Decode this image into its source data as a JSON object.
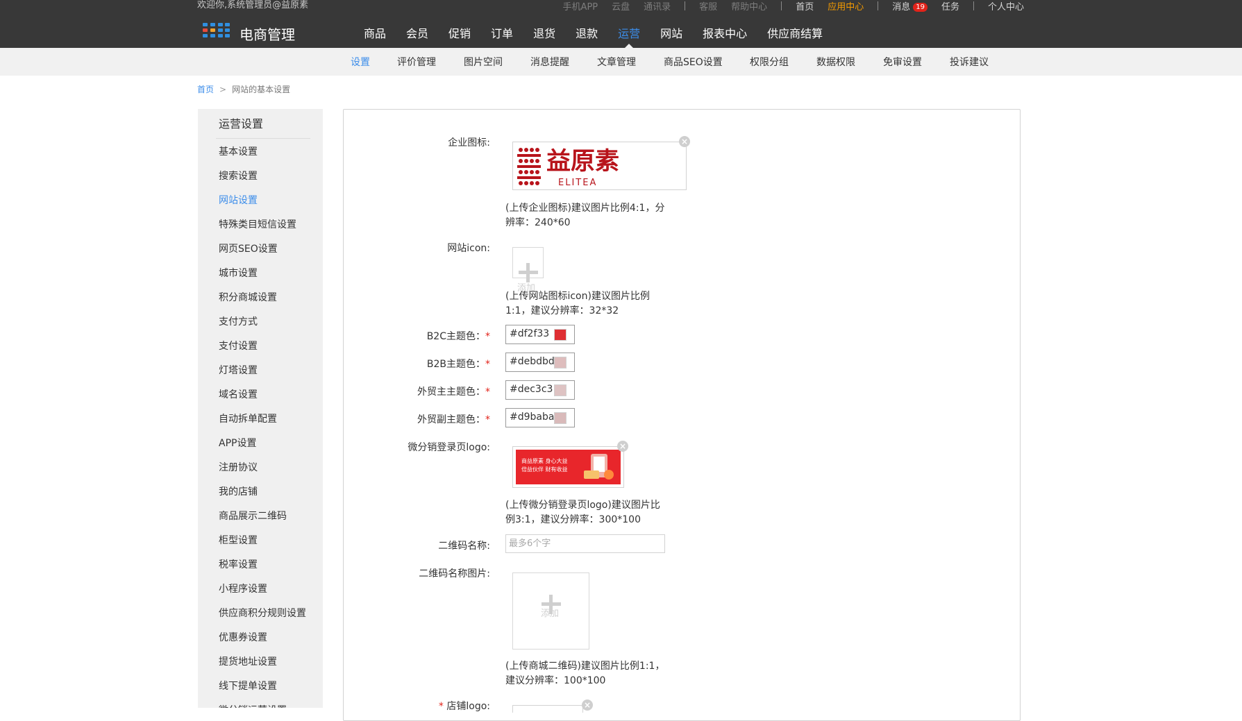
{
  "header": {
    "welcome": "欢迎你,系统管理员@益原素",
    "toplinks": {
      "mobile_app": "手机APP",
      "cloud": "云盘",
      "contacts": "通讯录",
      "service": "客服",
      "help": "帮助中心",
      "home": "首页",
      "app_center": "应用中心",
      "messages": "消息",
      "message_count": "19",
      "tasks": "任务",
      "personal": "个人中心"
    },
    "brand": "电商管理",
    "main_nav": [
      "商品",
      "会员",
      "促销",
      "订单",
      "退货",
      "退款",
      "运营",
      "网站",
      "报表中心",
      "供应商结算"
    ],
    "main_nav_active": "运营"
  },
  "subnav": {
    "items": [
      "设置",
      "评价管理",
      "图片空间",
      "消息提醒",
      "文章管理",
      "商品SEO设置",
      "权限分组",
      "数据权限",
      "免审设置",
      "投诉建议"
    ],
    "active": "设置"
  },
  "breadcrumb": {
    "home": "首页",
    "separator": ">",
    "current": "网站的基本设置"
  },
  "sidebar": {
    "title": "运营设置",
    "items": [
      "基本设置",
      "搜索设置",
      "网站设置",
      "特殊类目短信设置",
      "网页SEO设置",
      "城市设置",
      "积分商城设置",
      "支付方式",
      "支付设置",
      "灯塔设置",
      "域名设置",
      "自动拆单配置",
      "APP设置",
      "注册协议",
      "我的店铺",
      "商品展示二维码",
      "柜型设置",
      "税率设置",
      "小程序设置",
      "供应商积分规则设置",
      "优惠券设置",
      "提货地址设置",
      "线下提单设置",
      "微分销运营设置"
    ],
    "active": "网站设置"
  },
  "form": {
    "company_logo": {
      "label": "企业图标:",
      "logo_text_cn": "益原素",
      "logo_text_en": "ELITEA",
      "hint_line1": "(上传企业图标)建议图片比例4:1，分",
      "hint_line2": "辨率：240*60"
    },
    "site_icon": {
      "label": "网站icon:",
      "add": "添加",
      "hint_line1": "(上传网站图标icon)建议图片比例",
      "hint_line2": "1:1，建议分辨率：32*32"
    },
    "b2c_color": {
      "label": "B2C主题色：",
      "value": "#df2f33",
      "swatch": "#df2f33"
    },
    "b2b_color": {
      "label": "B2B主题色：",
      "value": "#debdbd",
      "swatch": "#debdbd"
    },
    "foreign_main_color": {
      "label": "外贸主主题色：",
      "value": "#dec3c3",
      "swatch": "#dec3c3"
    },
    "foreign_sub_color": {
      "label": "外贸副主题色：",
      "value": "#d9baba",
      "swatch": "#d9baba"
    },
    "required_mark": "*",
    "wdx_logo": {
      "label": "微分销登录页logo:",
      "banner_line1": "商益原素  身心大益",
      "banner_line2": "倍益伙伴  财有收益",
      "hint_line1": "(上传微分销登录页logo)建议图片比",
      "hint_line2": "例3:1，建议分辨率：300*100"
    },
    "qr_name": {
      "label": "二维码名称:",
      "placeholder": "最多6个字"
    },
    "qr_image": {
      "label": "二维码名称图片:",
      "add": "添加",
      "hint_line1": "(上传商城二维码)建议图片比例1:1，",
      "hint_line2": "建议分辨率：100*100"
    },
    "shop_logo": {
      "label": "店铺logo:"
    }
  },
  "colors": {
    "header_bg": "#383838",
    "subnav_bg": "#f1f1f1",
    "accent_blue": "#3c8dea",
    "accent_orange": "#f59b00",
    "badge_red": "#e2231a",
    "brand_red": "#b8141b"
  }
}
